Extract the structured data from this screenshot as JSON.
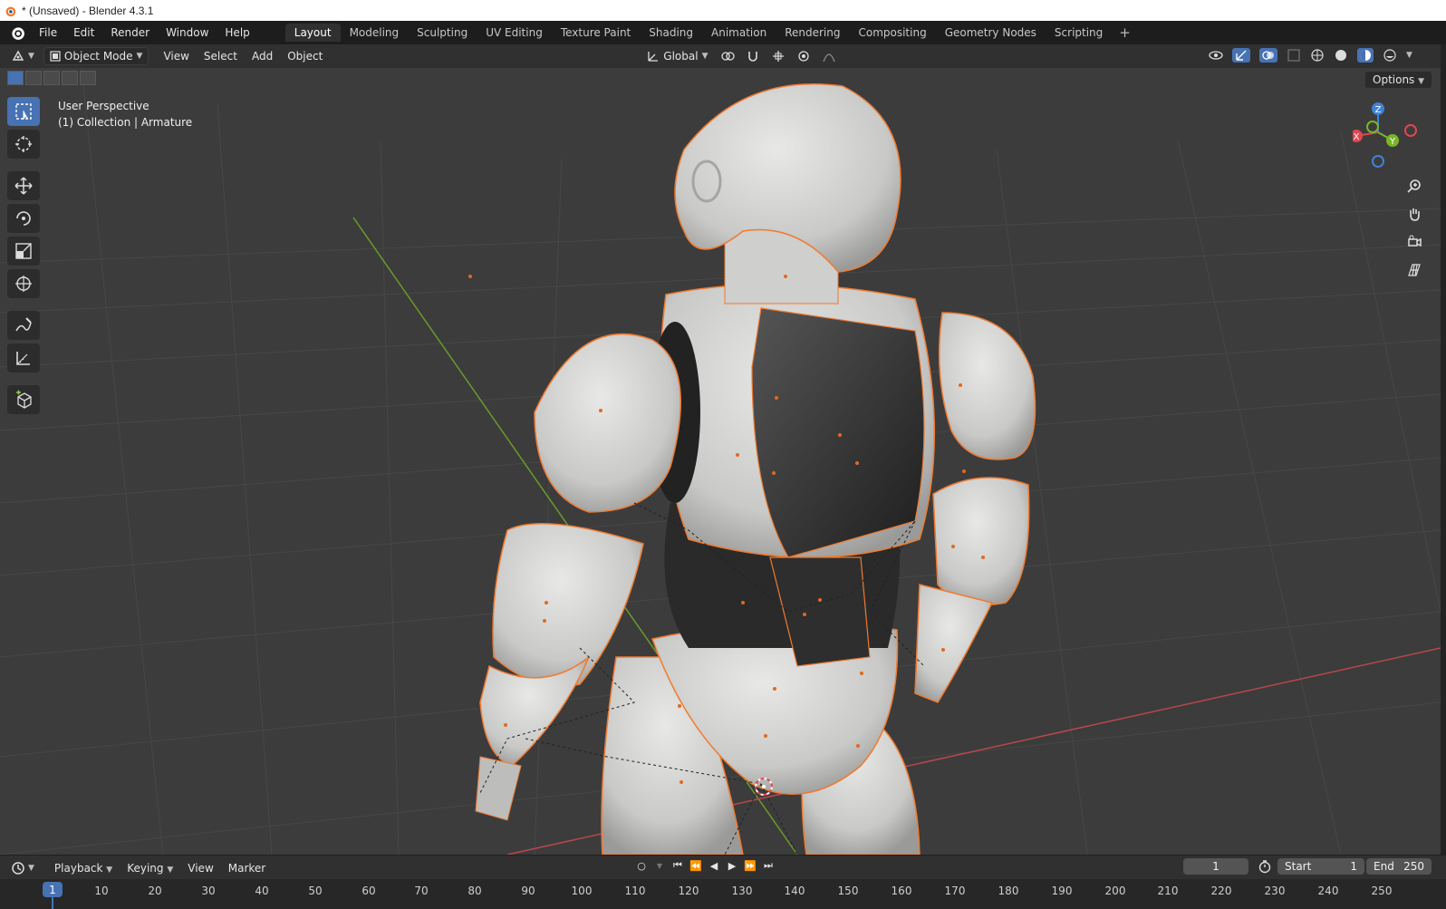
{
  "window": {
    "title": "* (Unsaved) - Blender 4.3.1"
  },
  "menubar": {
    "items": [
      "File",
      "Edit",
      "Render",
      "Window",
      "Help"
    ]
  },
  "workspaces": {
    "tabs": [
      "Layout",
      "Modeling",
      "Sculpting",
      "UV Editing",
      "Texture Paint",
      "Shading",
      "Animation",
      "Rendering",
      "Compositing",
      "Geometry Nodes",
      "Scripting"
    ],
    "active": "Layout",
    "add_label": "+"
  },
  "header": {
    "mode": "Object Mode",
    "menus": [
      "View",
      "Select",
      "Add",
      "Object"
    ],
    "orientation": "Global",
    "options_label": "Options"
  },
  "viewport": {
    "perspective": "User Perspective",
    "collection": "(1) Collection | Armature"
  },
  "gizmo": {
    "x": "X",
    "y": "Y",
    "z": "Z"
  },
  "timeline": {
    "menus": [
      "Playback",
      "Keying",
      "View",
      "Marker"
    ],
    "current_frame": "1",
    "start_label": "Start",
    "start_value": "1",
    "end_label": "End",
    "end_value": "250",
    "ruler_current": "1",
    "ruler_ticks": [
      "10",
      "20",
      "30",
      "40",
      "50",
      "60",
      "70",
      "80",
      "90",
      "100",
      "110",
      "120",
      "130",
      "140",
      "150",
      "160",
      "170",
      "180",
      "190",
      "200",
      "210",
      "220",
      "230",
      "240",
      "250"
    ]
  },
  "colors": {
    "accent": "#4772b3",
    "selection_outline": "#f07a30",
    "axis_x": "#e0474f",
    "axis_y": "#7bb42a",
    "axis_z": "#3f83d6"
  },
  "icons": {
    "tools": [
      "select-box-icon",
      "cursor-icon",
      "move-icon",
      "rotate-icon",
      "scale-icon",
      "transform-icon",
      "annotate-icon",
      "measure-icon",
      "add-cube-icon"
    ],
    "nav": [
      "zoom-icon",
      "pan-hand-icon",
      "camera-view-icon",
      "ortho-grid-icon"
    ]
  }
}
